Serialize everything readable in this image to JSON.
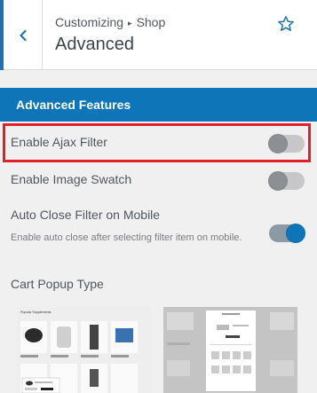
{
  "header": {
    "breadcrumb_root": "Customizing",
    "breadcrumb_sep": "▸",
    "breadcrumb_parent": "Shop",
    "title": "Advanced"
  },
  "section": {
    "title": "Advanced Features"
  },
  "options": [
    {
      "label": "Enable Ajax Filter",
      "enabled": false
    },
    {
      "label": "Enable Image Swatch",
      "enabled": false
    },
    {
      "label": "Auto Close Filter on Mobile",
      "enabled": true,
      "description": "Enable auto close after selecting filter item on mobile."
    }
  ],
  "cart_popup": {
    "label": "Cart Popup Type",
    "previews": [
      {
        "name": "popup-style-1",
        "heading": "Popular Supplements"
      },
      {
        "name": "popup-style-2"
      }
    ]
  },
  "colors": {
    "accent": "#0e75b8",
    "highlight": "#e0202a",
    "toggle_off": "#c7c7c9"
  }
}
